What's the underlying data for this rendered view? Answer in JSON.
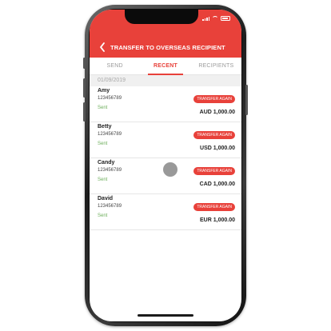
{
  "status_bar": {
    "time": ""
  },
  "header": {
    "title": "TRANSFER TO OVERSEAS RECIPIENT",
    "back_icon": "chevron-left-icon"
  },
  "tabs": [
    {
      "label": "SEND",
      "active": false
    },
    {
      "label": "RECENT",
      "active": true
    },
    {
      "label": "RECIPIENTS",
      "active": false
    }
  ],
  "date_header": "01/09/2019",
  "transfers": [
    {
      "name": "Amy",
      "account": "123456789",
      "status": "Sent",
      "action": "TRANSFER AGAIN",
      "amount": "AUD 1,000.00"
    },
    {
      "name": "Betty",
      "account": "123456789",
      "status": "Sent",
      "action": "TRANSFER AGAIN",
      "amount": "USD 1,000.00"
    },
    {
      "name": "Candy",
      "account": "123456789",
      "status": "Sent",
      "action": "TRANSFER AGAIN",
      "amount": "CAD 1,000.00"
    },
    {
      "name": "David",
      "account": "123456789",
      "status": "Sent",
      "action": "TRANSFER AGAIN",
      "amount": "EUR 1,000.00"
    }
  ],
  "colors": {
    "accent": "#e8413a",
    "sent": "#6cae5b"
  }
}
